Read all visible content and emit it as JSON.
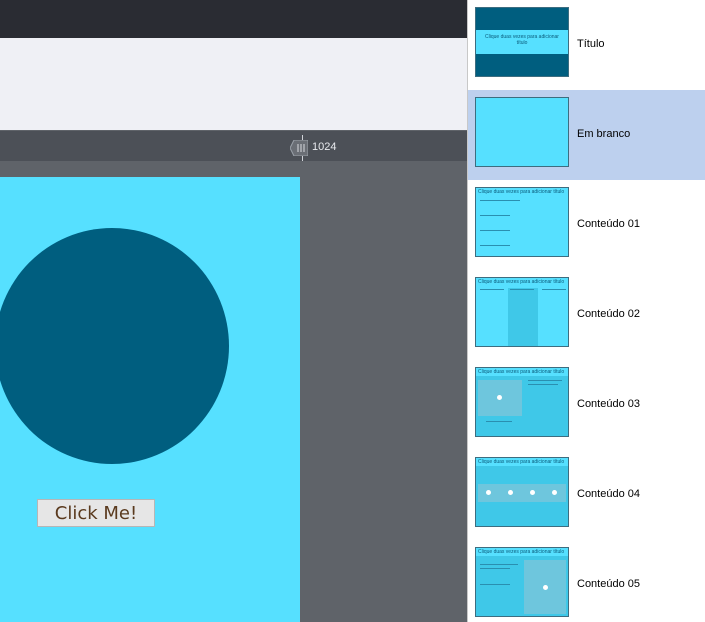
{
  "ruler": {
    "value": "1024"
  },
  "canvas": {
    "button_label": "Click Me!"
  },
  "colors": {
    "slide_bg": "#56e0ff",
    "circle": "#005e7f",
    "selected_row": "#bdd0ee",
    "topbar": "#2a2c33"
  },
  "layouts": [
    {
      "label": "Título",
      "thumb_text": "Clique duas vezes para adicionar título"
    },
    {
      "label": "Em branco"
    },
    {
      "label": "Conteúdo 01",
      "thumb_title": "Clique duas vezes para adicionar título"
    },
    {
      "label": "Conteúdo 02",
      "thumb_title": "Clique duas vezes para adicionar título"
    },
    {
      "label": "Conteúdo 03",
      "thumb_title": "Clique duas vezes para adicionar título"
    },
    {
      "label": "Conteúdo 04",
      "thumb_title": "Clique duas vezes para adicionar título"
    },
    {
      "label": "Conteúdo 05",
      "thumb_title": "Clique duas vezes para adicionar título"
    }
  ],
  "selected_layout": "Em branco"
}
